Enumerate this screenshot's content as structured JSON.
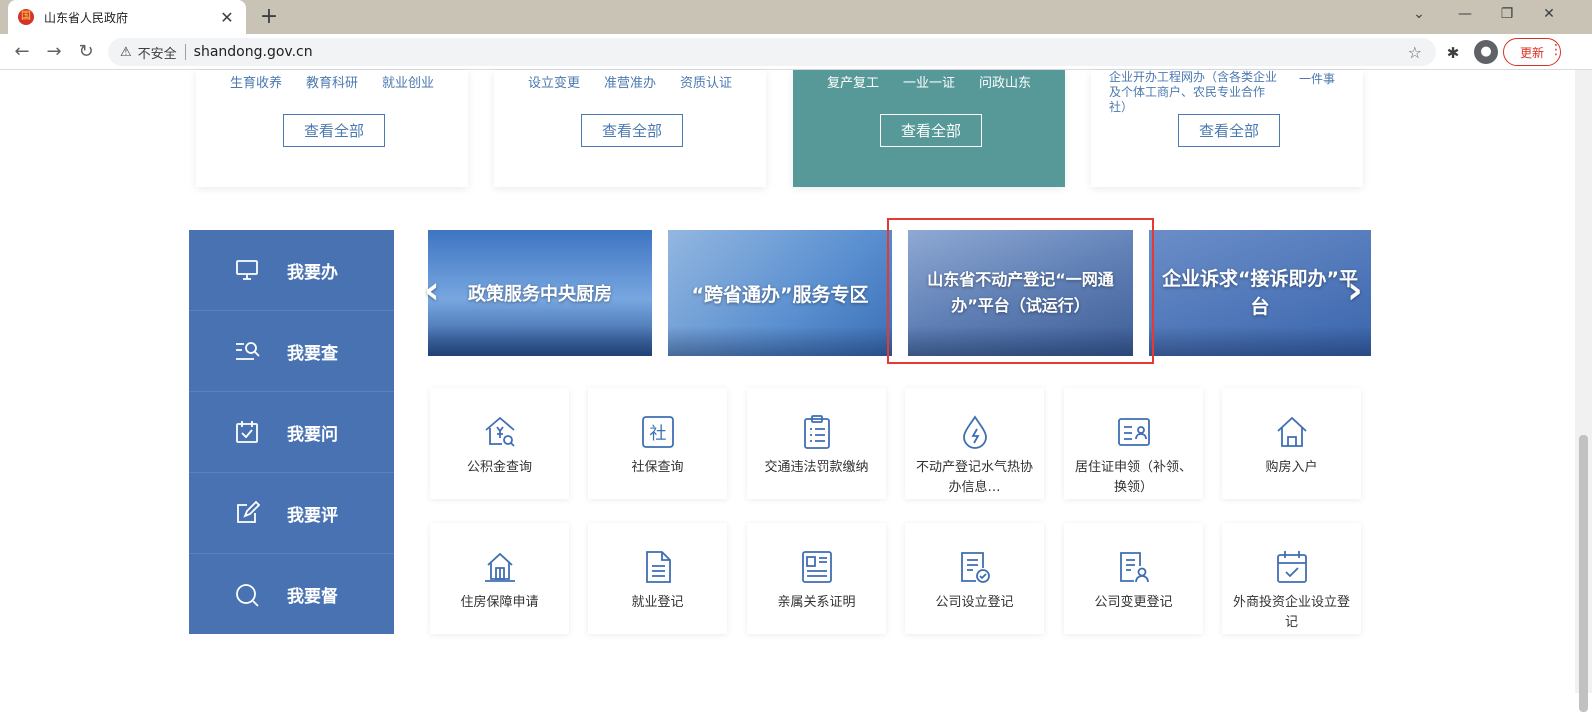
{
  "browser": {
    "tab_title": "山东省人民政府",
    "favicon": "国",
    "security_label": "不安全",
    "url": "shandong.gov.cn",
    "update_label": "更新"
  },
  "cards": [
    {
      "links": [
        "生育收养",
        "教育科研",
        "就业创业"
      ],
      "view_all": "查看全部"
    },
    {
      "links": [
        "设立变更",
        "准营准办",
        "资质认证"
      ],
      "view_all": "查看全部"
    },
    {
      "links": [
        "复产复工",
        "一业一证",
        "问政山东"
      ],
      "view_all": "查看全部"
    },
    {
      "text": "企业开办工程网办（含各类企业及个体工商户、农民专业合作社）",
      "extra": "一件事",
      "view_all": "查看全部"
    }
  ],
  "sidemenu": [
    "我要办",
    "我要查",
    "我要问",
    "我要评",
    "我要督"
  ],
  "banners": [
    "政策服务中央厨房",
    "“跨省通办”服务专区",
    "山东省不动产登记“一网通办”平台（试运行）",
    "企业诉求“接诉即办”平台"
  ],
  "tiles": [
    "公积金查询",
    "社保查询",
    "交通违法罚款缴纳",
    "不动产登记水气热协办信息…",
    "居住证申领（补领、换领）",
    "购房入户",
    "住房保障申请",
    "就业登记",
    "亲属关系证明",
    "公司设立登记",
    "公司变更登记",
    "外商投资企业设立登记"
  ],
  "colors": {
    "accent": "#4872b2",
    "active_card": "#569998",
    "highlight": "#e53935"
  }
}
